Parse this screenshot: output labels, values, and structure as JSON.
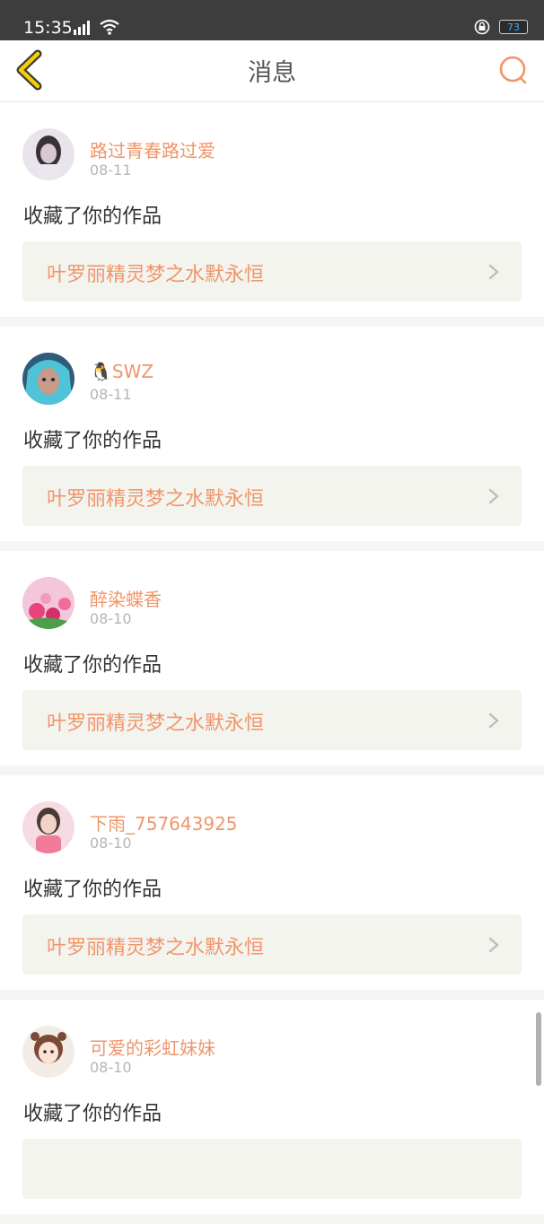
{
  "status_bar": {
    "time": "15:35",
    "battery": "73"
  },
  "nav": {
    "title": "消息"
  },
  "action_label": "收藏了你的作品",
  "notifications": [
    {
      "user": "路过青春路过爱",
      "date": "08-11",
      "action": "收藏了你的作品",
      "work": "叶罗丽精灵梦之水默永恒"
    },
    {
      "user": "🐧SWZ",
      "date": "08-11",
      "action": "收藏了你的作品",
      "work": "叶罗丽精灵梦之水默永恒"
    },
    {
      "user": "醉染蝶香",
      "date": "08-10",
      "action": "收藏了你的作品",
      "work": "叶罗丽精灵梦之水默永恒"
    },
    {
      "user": "下雨_757643925",
      "date": "08-10",
      "action": "收藏了你的作品",
      "work": "叶罗丽精灵梦之水默永恒"
    },
    {
      "user": "可爱的彩虹妹妹",
      "date": "08-10",
      "action": "收藏了你的作品",
      "work": ""
    }
  ],
  "colors": {
    "accent": "#f0956a",
    "status_bar": "#3d3d3d",
    "back_icon": "#f5d000"
  }
}
